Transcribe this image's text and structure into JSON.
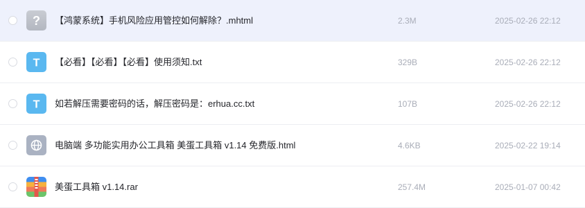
{
  "colors": {
    "hover_row_bg": "#eef1fc",
    "txt_icon": "#5ab8f0",
    "unknown_icon": "#bfc3cc",
    "html_icon": "#a9b2c3",
    "meta_text": "#a9adb8"
  },
  "files": [
    {
      "name": "【鸿蒙系统】手机风险应用管控如何解除？.mhtml",
      "size": "2.3M",
      "date": "2025-02-26 22:12",
      "icon": "unknown-file-icon",
      "icon_letter": "?"
    },
    {
      "name": "【必看】【必看】【必看】使用须知.txt",
      "size": "329B",
      "date": "2025-02-26 22:12",
      "icon": "txt-file-icon",
      "icon_letter": "T"
    },
    {
      "name": "如若解压需要密码的话，解压密码是：erhua.cc.txt",
      "size": "107B",
      "date": "2025-02-26 22:12",
      "icon": "txt-file-icon",
      "icon_letter": "T"
    },
    {
      "name": "电脑端 多功能实用办公工具箱 美蛋工具箱 v1.14 免费版.html",
      "size": "4.6KB",
      "date": "2025-02-22 19:14",
      "icon": "html-file-icon",
      "icon_letter": ""
    },
    {
      "name": "美蛋工具箱 v1.14.rar",
      "size": "257.4M",
      "date": "2025-01-07 00:42",
      "icon": "archive-file-icon",
      "icon_letter": ""
    }
  ]
}
